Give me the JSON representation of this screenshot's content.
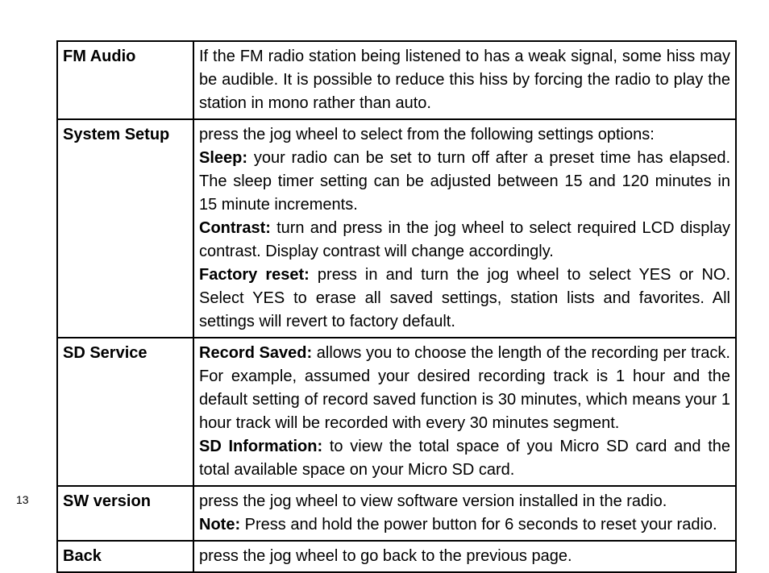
{
  "page_number": "13",
  "rows": {
    "fm_audio": {
      "label": "FM Audio",
      "text": "If the FM radio station being listened to has a weak signal, some hiss may be audible. It is possible to reduce this hiss by forcing the radio to play the station in mono rather than auto."
    },
    "system_setup": {
      "label": "System Setup",
      "intro": "press the jog wheel to select from the following settings options:",
      "sleep_label": "Sleep:",
      "sleep_text": " your radio can be set to turn off after a preset time has elapsed. The sleep timer setting can be adjusted between 15 and 120 minutes in 15 minute increments.",
      "contrast_label": "Contrast:",
      "contrast_text": " turn and press in the jog wheel to select required LCD display contrast. Display contrast will change accordingly.",
      "factory_label": "Factory reset:",
      "factory_text": " press in and turn the jog wheel to select YES or NO. Select YES to erase all saved settings, station lists and favorites. All settings will revert to factory default."
    },
    "sd_service": {
      "label": "SD Service",
      "record_label": "Record Saved:",
      "record_text": " allows you to choose the length of the recording per track. For example, assumed your desired recording track is 1 hour and the default setting of record saved function is 30 minutes, which means your 1 hour track will be recorded with every 30 minutes segment.",
      "sdinfo_label": "SD Information:",
      "sdinfo_text": " to view the total space of you Micro SD card and the total available space on your Micro SD card."
    },
    "sw_version": {
      "label": "SW version",
      "line1": "press the jog wheel to view software version installed in the radio.",
      "note_label": "Note:",
      "note_text": " Press and hold the power button for 6 seconds to reset your radio."
    },
    "back": {
      "label": "Back",
      "text": "press the jog wheel to go back to the previous page."
    }
  }
}
